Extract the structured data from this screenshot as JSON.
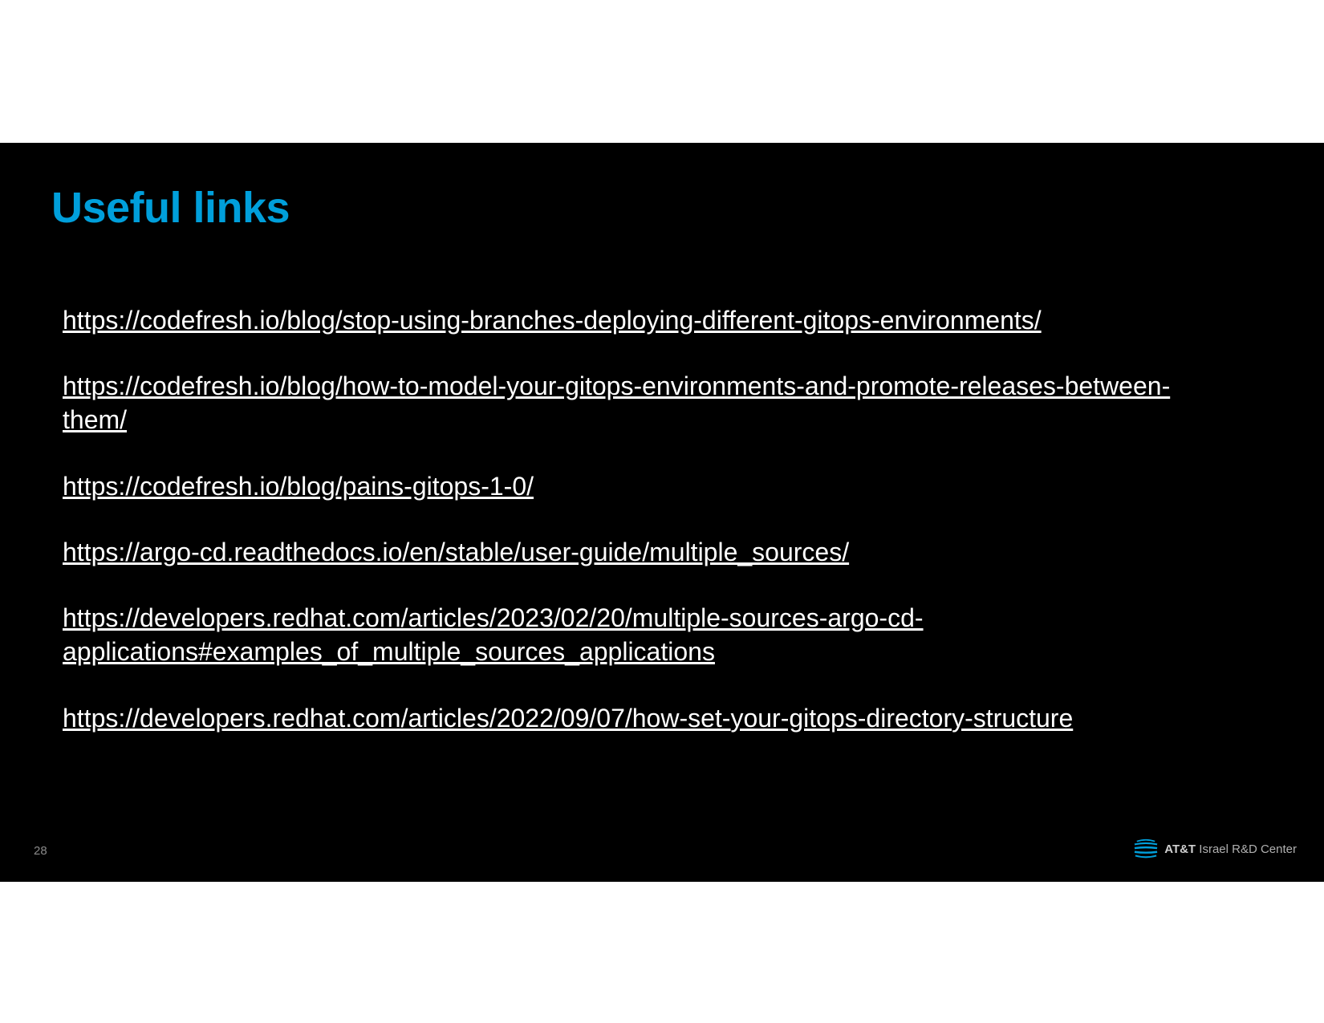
{
  "title": "Useful links",
  "links": [
    "https://codefresh.io/blog/stop-using-branches-deploying-different-gitops-environments/",
    "https://codefresh.io/blog/how-to-model-your-gitops-environments-and-promote-releases-between-them/",
    "https://codefresh.io/blog/pains-gitops-1-0/",
    "https://argo-cd.readthedocs.io/en/stable/user-guide/multiple_sources/",
    "https://developers.redhat.com/articles/2023/02/20/multiple-sources-argo-cd-applications#examples_of_multiple_sources_applications",
    "https://developers.redhat.com/articles/2022/09/07/how-set-your-gitops-directory-structure"
  ],
  "page_number": "28",
  "footer": {
    "brand": "AT&T",
    "rest": "Israel R&D Center"
  },
  "colors": {
    "accent": "#009FDB",
    "bg": "#000000",
    "text": "#ffffff"
  }
}
